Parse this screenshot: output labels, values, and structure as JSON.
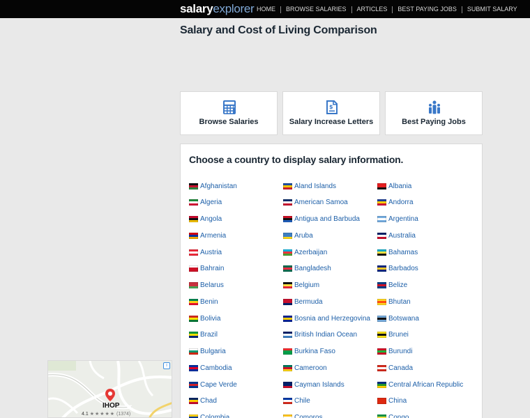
{
  "header": {
    "logo_part1": "salary",
    "logo_part2": "explorer",
    "nav": [
      "HOME",
      "BROWSE SALARIES",
      "ARTICLES",
      "BEST PAYING JOBS",
      "SUBMIT SALARY"
    ]
  },
  "page_title": "Salary and Cost of Living Comparison",
  "cards": [
    {
      "label": "Browse Salaries",
      "icon": "calculator-icon"
    },
    {
      "label": "Salary Increase Letters",
      "icon": "document-dollar-icon"
    },
    {
      "label": "Best Paying Jobs",
      "icon": "people-icon"
    }
  ],
  "countries_heading": "Choose a country to display salary information.",
  "countries": [
    {
      "name": "Afghanistan",
      "flag": [
        "#111111",
        "#c8102e",
        "#2e8540"
      ]
    },
    {
      "name": "Aland Islands",
      "flag": [
        "#1f4fa0",
        "#f2c500",
        "#d21f2a"
      ]
    },
    {
      "name": "Albania",
      "flag": [
        "#e41e20",
        "#e41e20",
        "#111111"
      ]
    },
    {
      "name": "Algeria",
      "flag": [
        "#1d8a3a",
        "#ffffff",
        "#d21034"
      ]
    },
    {
      "name": "American Samoa",
      "flag": [
        "#0b2d6b",
        "#ffffff",
        "#c8102e"
      ]
    },
    {
      "name": "Andorra",
      "flag": [
        "#1f3f99",
        "#f5cd00",
        "#d21034"
      ]
    },
    {
      "name": "Angola",
      "flag": [
        "#cc092f",
        "#111111",
        "#f5c200"
      ]
    },
    {
      "name": "Antigua and Barbuda",
      "flag": [
        "#ce1126",
        "#111111",
        "#1f5fbf"
      ]
    },
    {
      "name": "Argentina",
      "flag": [
        "#74acdf",
        "#ffffff",
        "#74acdf"
      ]
    },
    {
      "name": "Armenia",
      "flag": [
        "#d90012",
        "#0033a0",
        "#f2a800"
      ]
    },
    {
      "name": "Aruba",
      "flag": [
        "#3e7fc1",
        "#3e7fc1",
        "#f9d616"
      ]
    },
    {
      "name": "Australia",
      "flag": [
        "#012169",
        "#ffffff",
        "#c8102e"
      ]
    },
    {
      "name": "Austria",
      "flag": [
        "#ed2939",
        "#ffffff",
        "#ed2939"
      ]
    },
    {
      "name": "Azerbaijan",
      "flag": [
        "#00b5e2",
        "#ef3340",
        "#509e2f"
      ]
    },
    {
      "name": "Bahamas",
      "flag": [
        "#00abc9",
        "#fae042",
        "#111111"
      ]
    },
    {
      "name": "Bahrain",
      "flag": [
        "#ffffff",
        "#ce1126",
        "#ce1126"
      ]
    },
    {
      "name": "Bangladesh",
      "flag": [
        "#006a4e",
        "#f42a41",
        "#006a4e"
      ]
    },
    {
      "name": "Barbados",
      "flag": [
        "#00267f",
        "#ffc726",
        "#00267f"
      ]
    },
    {
      "name": "Belarus",
      "flag": [
        "#c8313e",
        "#c8313e",
        "#4aa657"
      ]
    },
    {
      "name": "Belgium",
      "flag": [
        "#111111",
        "#fae042",
        "#ed2939"
      ]
    },
    {
      "name": "Belize",
      "flag": [
        "#003f87",
        "#ce1126",
        "#003f87"
      ]
    },
    {
      "name": "Benin",
      "flag": [
        "#008751",
        "#fcd116",
        "#e8112d"
      ]
    },
    {
      "name": "Bermuda",
      "flag": [
        "#c8102e",
        "#c8102e",
        "#012169"
      ]
    },
    {
      "name": "Bhutan",
      "flag": [
        "#ffd520",
        "#ff4e12",
        "#ffd520"
      ]
    },
    {
      "name": "Bolivia",
      "flag": [
        "#d52b1e",
        "#f9e300",
        "#007934"
      ]
    },
    {
      "name": "Bosnia and Herzegovina",
      "flag": [
        "#002395",
        "#fecb00",
        "#002395"
      ]
    },
    {
      "name": "Botswana",
      "flag": [
        "#75aadb",
        "#111111",
        "#75aadb"
      ]
    },
    {
      "name": "Brazil",
      "flag": [
        "#009c3b",
        "#ffdf00",
        "#002776"
      ]
    },
    {
      "name": "British Indian Ocean",
      "flag": [
        "#012169",
        "#ffffff",
        "#3e7fc1"
      ]
    },
    {
      "name": "Brunei",
      "flag": [
        "#f7e017",
        "#111111",
        "#f7e017"
      ]
    },
    {
      "name": "Bulgaria",
      "flag": [
        "#ffffff",
        "#00966e",
        "#d62612"
      ]
    },
    {
      "name": "Burkina Faso",
      "flag": [
        "#ef2b2d",
        "#009e49",
        "#009e49"
      ]
    },
    {
      "name": "Burundi",
      "flag": [
        "#ce1126",
        "#1eb53a",
        "#ce1126"
      ]
    },
    {
      "name": "Cambodia",
      "flag": [
        "#032ea1",
        "#e00025",
        "#032ea1"
      ]
    },
    {
      "name": "Cameroon",
      "flag": [
        "#007a5e",
        "#ce1126",
        "#fcd116"
      ]
    },
    {
      "name": "Canada",
      "flag": [
        "#d52b1e",
        "#ffffff",
        "#d52b1e"
      ]
    },
    {
      "name": "Cape Verde",
      "flag": [
        "#003893",
        "#cf2027",
        "#003893"
      ]
    },
    {
      "name": "Cayman Islands",
      "flag": [
        "#012169",
        "#012169",
        "#c8102e"
      ]
    },
    {
      "name": "Central African Republic",
      "flag": [
        "#003082",
        "#289728",
        "#ffce00"
      ]
    },
    {
      "name": "Chad",
      "flag": [
        "#002664",
        "#fecb00",
        "#c60c30"
      ]
    },
    {
      "name": "Chile",
      "flag": [
        "#0039a6",
        "#ffffff",
        "#d52b1e"
      ]
    },
    {
      "name": "China",
      "flag": [
        "#de2910",
        "#de2910",
        "#de2910"
      ]
    },
    {
      "name": "Colombia",
      "flag": [
        "#fcd116",
        "#003893",
        "#ce1126"
      ]
    },
    {
      "name": "Comoros",
      "flag": [
        "#ffc61e",
        "#ffffff",
        "#3a75c4"
      ]
    },
    {
      "name": "Congo",
      "flag": [
        "#009543",
        "#fbde4a",
        "#dc241f"
      ]
    }
  ],
  "ad": {
    "place_name": "IHOP",
    "rating": "4.1",
    "stars": "★★★★★",
    "reviews": "(1374)",
    "info_label": "i"
  }
}
